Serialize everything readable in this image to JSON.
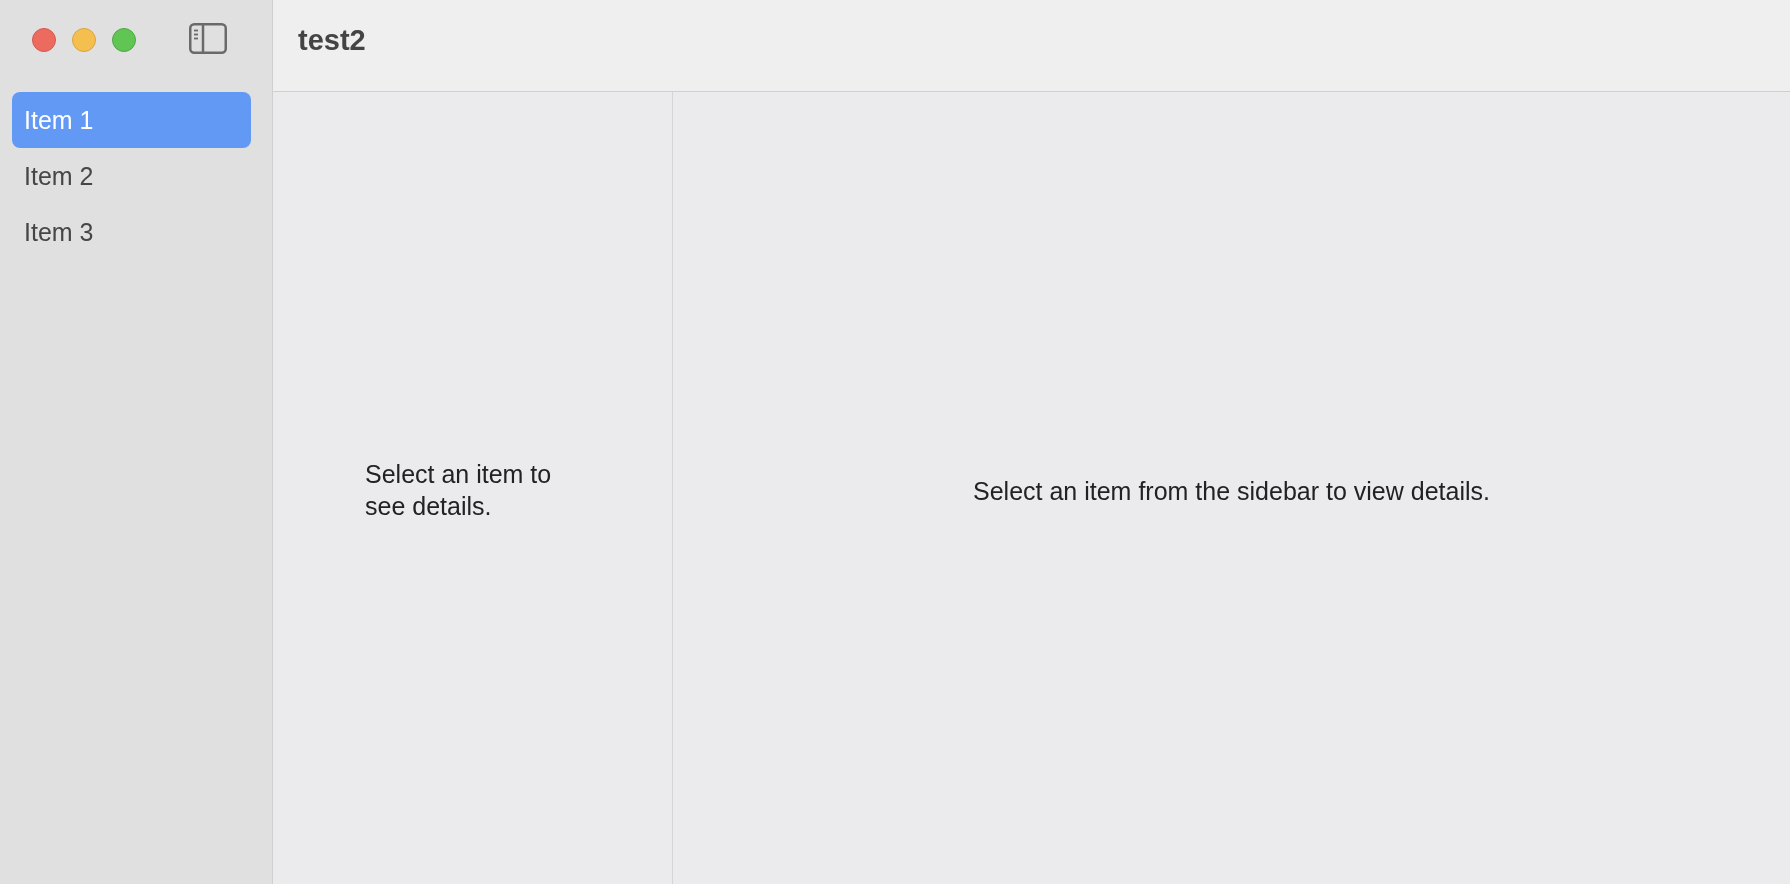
{
  "window": {
    "title": "test2"
  },
  "sidebar": {
    "items": [
      {
        "label": "Item 1",
        "selected": true
      },
      {
        "label": "Item 2",
        "selected": false
      },
      {
        "label": "Item 3",
        "selected": false
      }
    ]
  },
  "list_pane": {
    "message": "Select an item to see details."
  },
  "detail_pane": {
    "message": "Select an item from the sidebar to view details."
  }
}
